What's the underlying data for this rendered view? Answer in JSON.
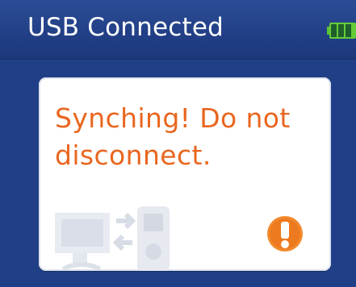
{
  "header": {
    "title": "USB Connected",
    "battery_icon": "battery-full-icon",
    "battery_level": 1
  },
  "dialog": {
    "message": "Synching! Do not disconnect.",
    "illustration_icon": "computer-to-player-sync-icon",
    "alert_icon": "exclamation-icon",
    "colors": {
      "message": "#e9661f",
      "alert": "#f28a2e",
      "header": "#223f86"
    }
  }
}
